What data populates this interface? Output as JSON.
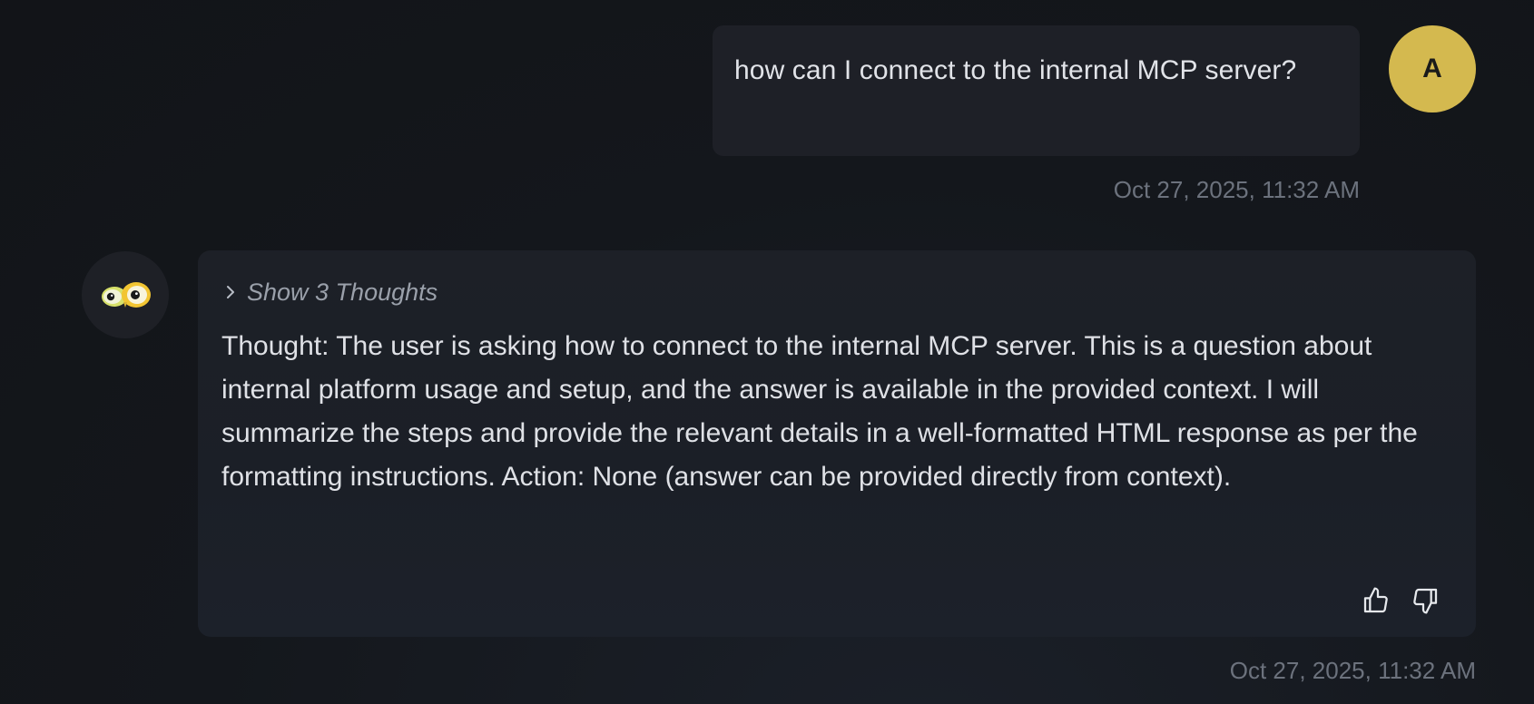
{
  "user_message": {
    "text": "how can I connect to the internal MCP server?",
    "avatar_initial": "A",
    "avatar_color": "#d4b94f",
    "timestamp": "Oct 27, 2025, 11:32 AM"
  },
  "bot_message": {
    "avatar_icon": "owl-eyes-icon",
    "thoughts_toggle_label": "Show 3 Thoughts",
    "text": "Thought: The user is asking how to connect to the internal MCP server. This is a question about internal platform usage and setup, and the answer is available in the provided context. I will summarize the steps and provide the relevant details in a well-formatted HTML response as per the formatting instructions. Action: None (answer can be provided directly from context).",
    "timestamp": "Oct 27, 2025, 11:32 AM",
    "feedback_icons": [
      "thumbs-up-icon",
      "thumbs-down-icon"
    ]
  }
}
